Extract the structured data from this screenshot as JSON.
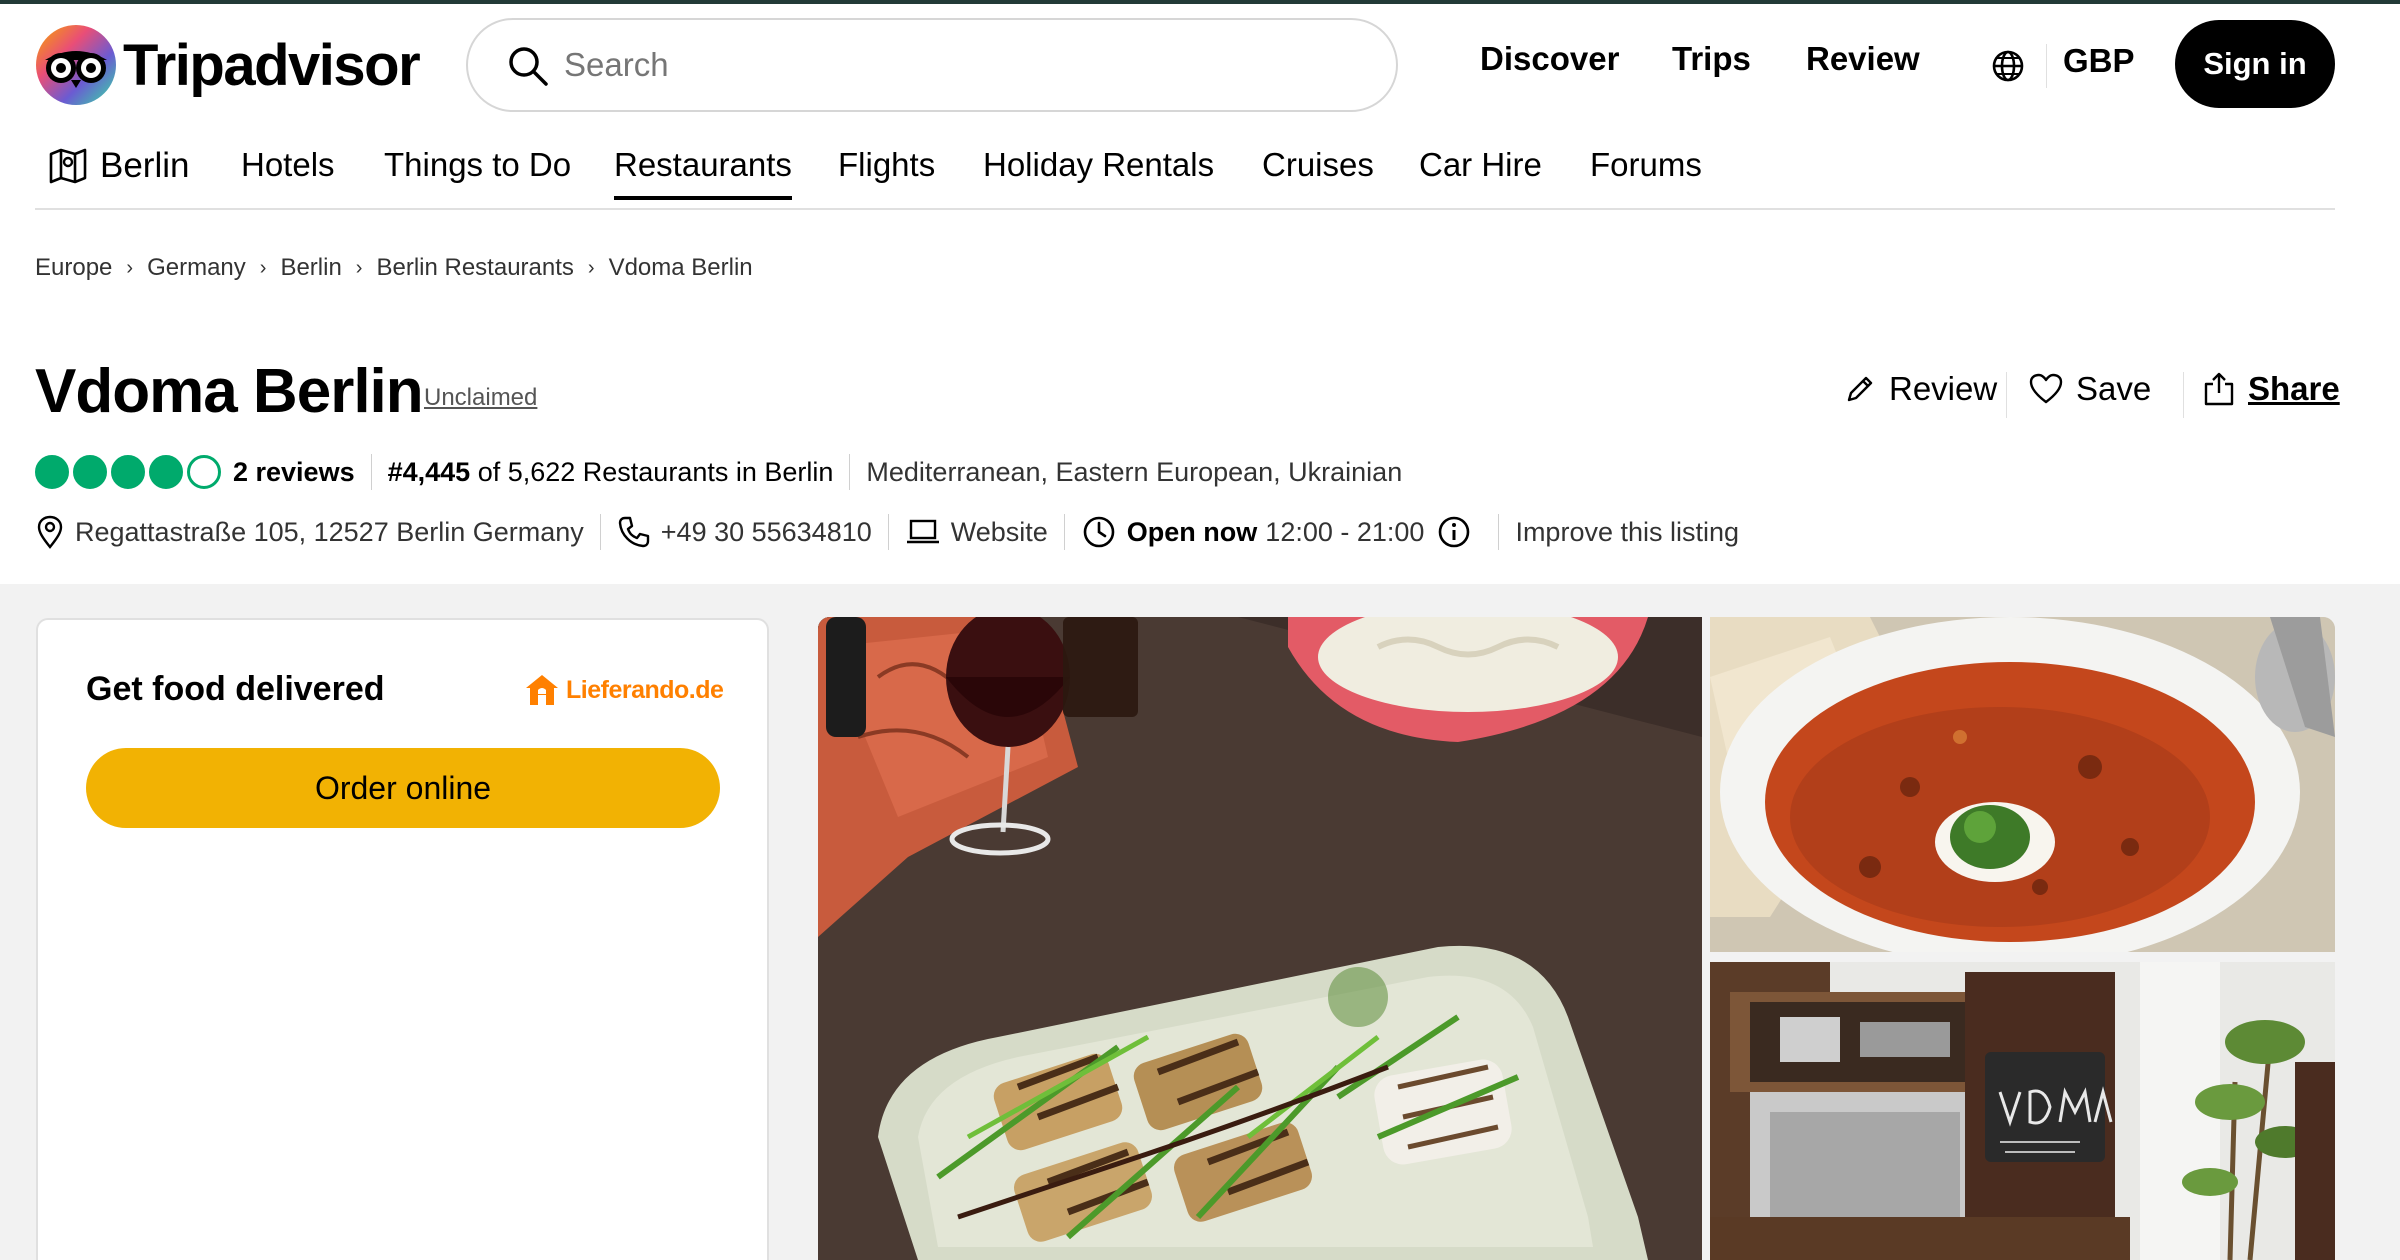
{
  "brand": {
    "name": "Tripadvisor"
  },
  "search": {
    "placeholder": "Search"
  },
  "top_nav": {
    "discover": "Discover",
    "trips": "Trips",
    "review": "Review",
    "currency": "GBP",
    "sign_in": "Sign in"
  },
  "sub_nav": {
    "city": "Berlin",
    "items": [
      "Hotels",
      "Things to Do",
      "Restaurants",
      "Flights",
      "Holiday Rentals",
      "Cruises",
      "Car Hire",
      "Forums"
    ],
    "active": "Restaurants"
  },
  "breadcrumb": [
    "Europe",
    "Germany",
    "Berlin",
    "Berlin Restaurants",
    "Vdoma Berlin"
  ],
  "listing": {
    "name": "Vdoma Berlin",
    "claim_status": "Unclaimed",
    "actions": {
      "review": "Review",
      "save": "Save",
      "share": "Share"
    },
    "rating": {
      "bubbles_filled": 4,
      "bubbles_total": 5
    },
    "reviews": "2 reviews",
    "rank": "#4,445",
    "rank_suffix": " of 5,622 Restaurants in Berlin",
    "cuisines": "Mediterranean, Eastern European, Ukrainian",
    "address": "Regattastraße 105, 12527 Berlin Germany",
    "phone": "+49 30 55634810",
    "website": "Website",
    "open_status": "Open now",
    "hours": "12:00 - 21:00",
    "improve": "Improve this listing"
  },
  "delivery": {
    "title": "Get food delivered",
    "provider": "Lieferando.de",
    "order_button": "Order online"
  },
  "colors": {
    "rating_green": "#00aa6c",
    "order_yellow": "#f2b203",
    "lieferando_orange": "#ff8000",
    "header_line": "#223a37"
  },
  "photos": [
    "food-platter-with-wine",
    "soup-bowl",
    "restaurant-interior"
  ]
}
